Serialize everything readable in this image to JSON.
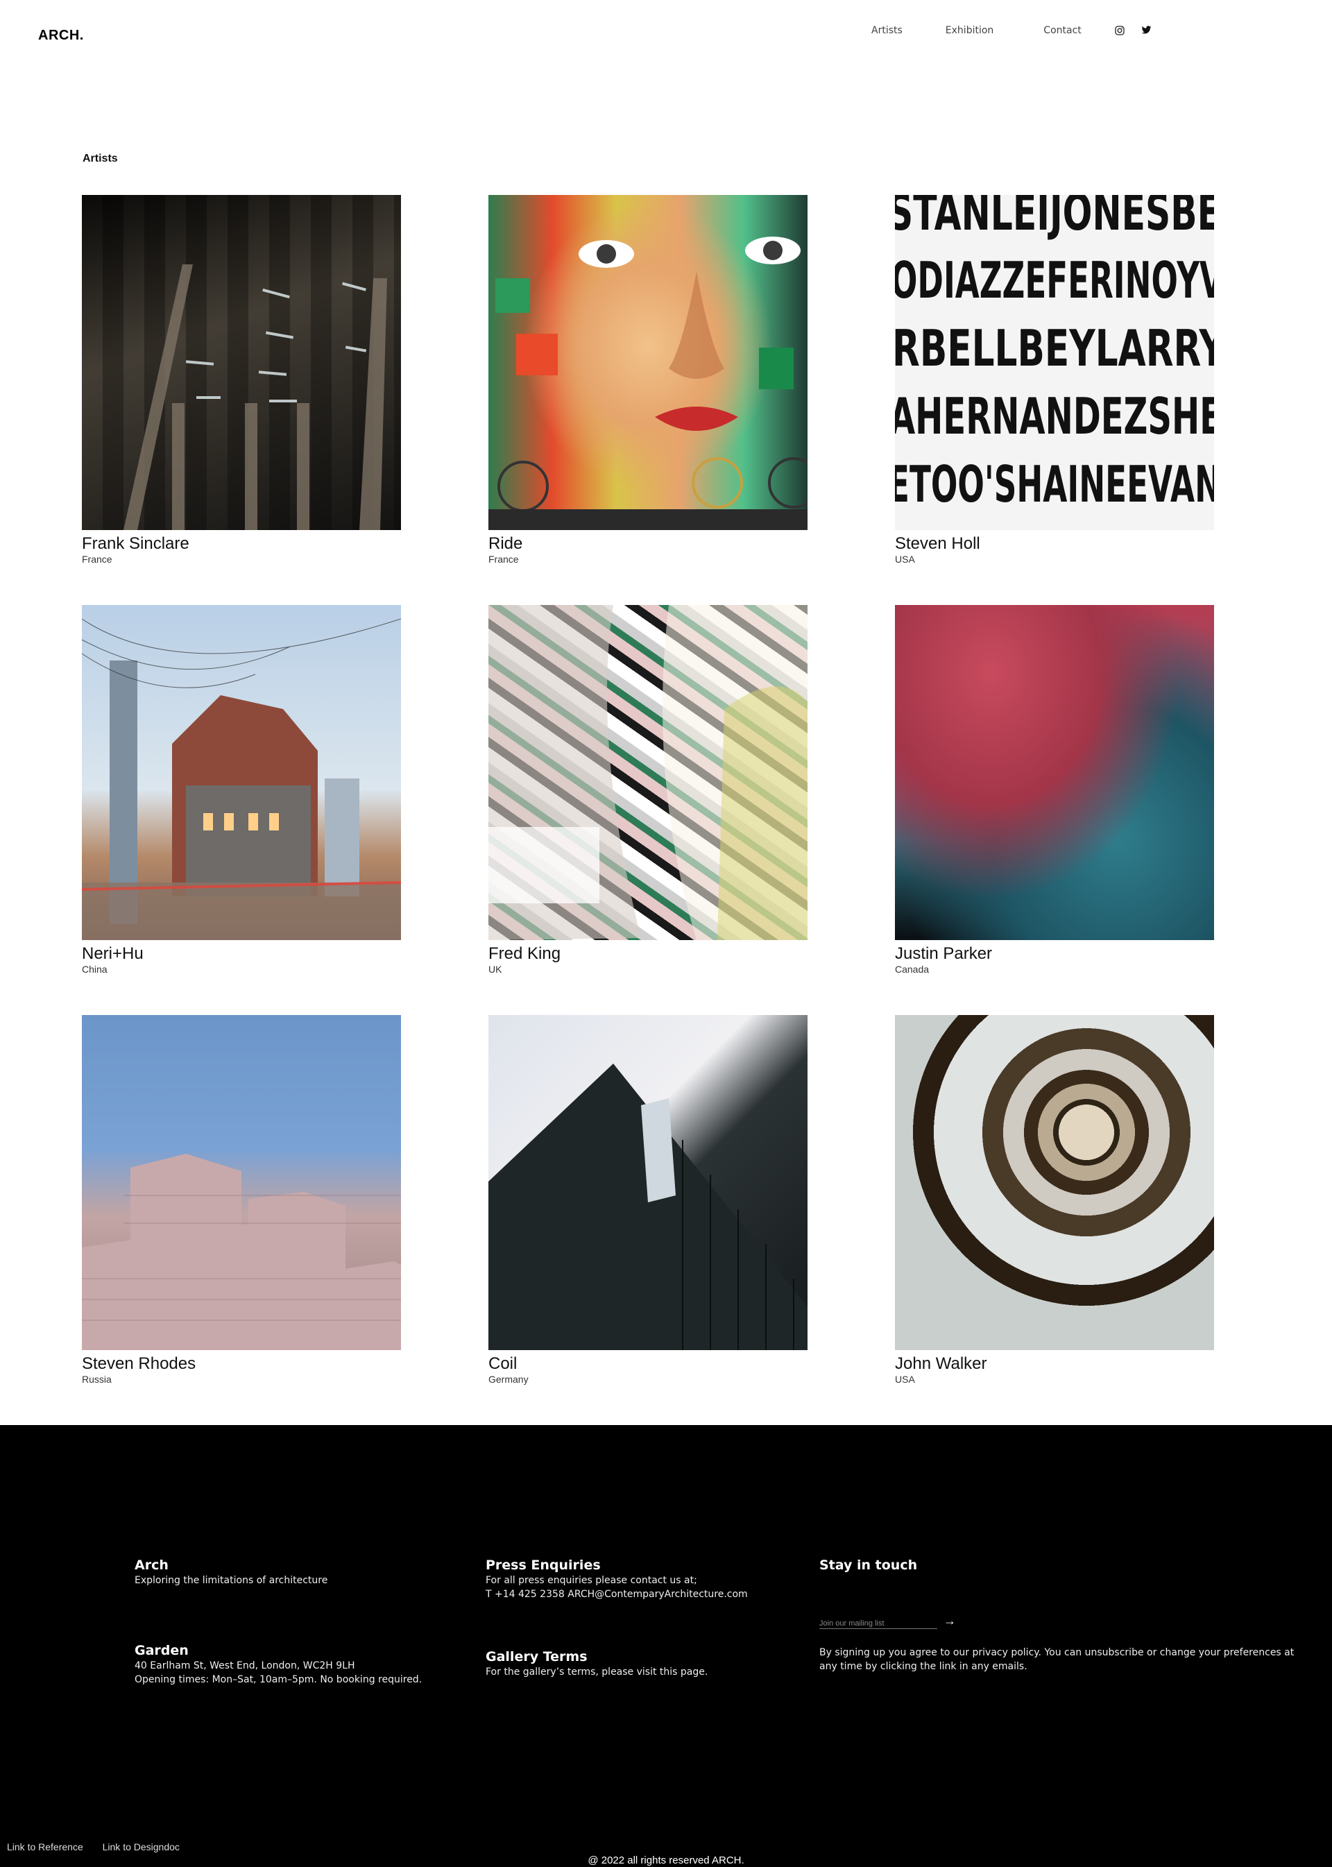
{
  "header": {
    "logo": "ARCH.",
    "nav": [
      "Artists",
      "Exhibition",
      "Contact"
    ],
    "social_icons": [
      "instagram-icon",
      "twitter-icon"
    ]
  },
  "main": {
    "section_title": "Artists",
    "artists": [
      {
        "name": "Frank Sinclare",
        "country": "France"
      },
      {
        "name": "Ride",
        "country": "France"
      },
      {
        "name": "Steven Holl",
        "country": "USA"
      },
      {
        "name": "Neri+Hu",
        "country": "China"
      },
      {
        "name": "Fred King",
        "country": "UK"
      },
      {
        "name": "Justin Parker",
        "country": "Canada"
      },
      {
        "name": "Steven Rhodes",
        "country": "Russia"
      },
      {
        "name": "Coil",
        "country": "Germany"
      },
      {
        "name": "John Walker",
        "country": "USA"
      }
    ],
    "image3_text": [
      "STANLEIJONESBE",
      "ODIAZZEFERINOYV",
      "RBELLBEYLARRY",
      "AHERNANDEZSHE",
      "ETOO'SHAINEEVAN"
    ]
  },
  "footer": {
    "arch": {
      "title": "Arch",
      "text": "Exploring the limitations of architecture"
    },
    "garden": {
      "title": "Garden",
      "address": "40 Earlham St, West End, London, WC2H 9LH",
      "hours": "Opening times: Mon–Sat, 10am–5pm. No booking required."
    },
    "press": {
      "title": "Press Enquiries",
      "line1": "For all press enquiries please contact us at;",
      "line2": "T +14 425 2358 ARCH@ContemparyArchitecture.com"
    },
    "terms": {
      "title": "Gallery Terms",
      "text": "For the gallery’s terms, please visit this page."
    },
    "stay": {
      "title": "Stay in touch",
      "mailing_placeholder": "Join our mailing list",
      "arrow": "→",
      "policy": "By signing up you agree to our privacy policy. You can unsubscribe or change your preferences at any time by clicking the link in any emails."
    },
    "links": [
      "Link to Reference",
      "Link to Designdoc"
    ],
    "copyright": "@ 2022 all rights reserved ARCH."
  }
}
